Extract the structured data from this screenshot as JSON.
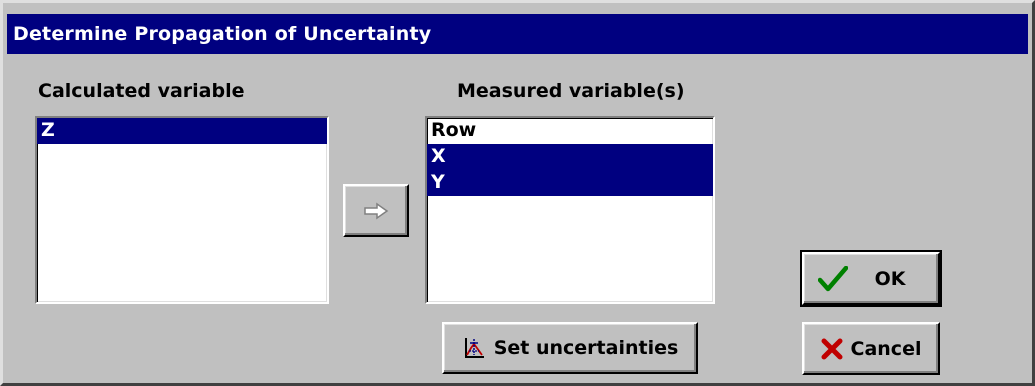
{
  "window": {
    "title": "Determine Propagation of Uncertainty"
  },
  "calculated": {
    "label": "Calculated variable",
    "items": [
      {
        "text": "Z",
        "selected": true
      }
    ]
  },
  "measured": {
    "label": "Measured variable(s)",
    "items": [
      {
        "text": "Row",
        "selected": false
      },
      {
        "text": "X",
        "selected": true
      },
      {
        "text": "Y",
        "selected": true
      }
    ]
  },
  "buttons": {
    "transfer_icon": "right-arrow-icon",
    "set_uncertainties_label": "Set uncertainties",
    "set_uncertainties_icon": "chart-icon",
    "ok_label": "OK",
    "ok_icon": "checkmark-icon",
    "cancel_label": "Cancel",
    "cancel_icon": "x-mark-icon"
  },
  "colors": {
    "titlebar": "#000080",
    "selection": "#000080",
    "ok_check": "#008000",
    "cancel_x": "#c00000"
  }
}
